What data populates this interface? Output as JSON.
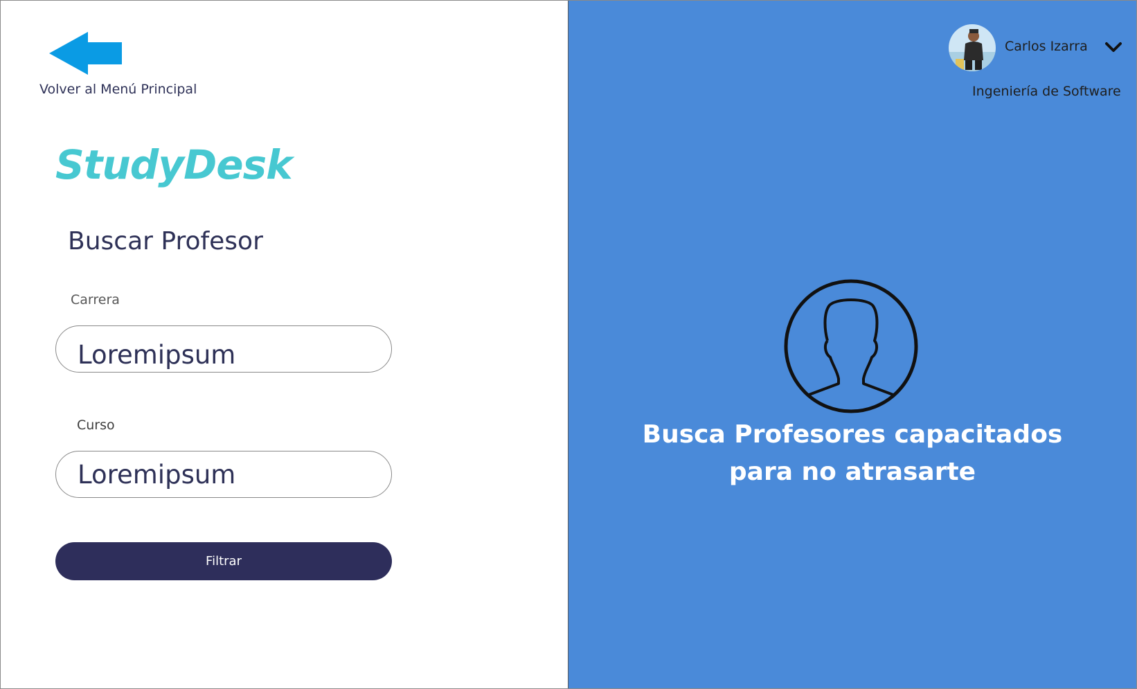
{
  "navigation": {
    "back_label": "Volver al Menú Principal",
    "back_icon": "arrow-left-icon",
    "arrow_color": "#0a9be4"
  },
  "brand": {
    "name": "StudyDesk",
    "color": "#47c8d1"
  },
  "search_form": {
    "title": "Buscar Profesor",
    "career_label": "Carrera",
    "career_value": "Loremipsum",
    "course_label": "Curso",
    "course_value": "Loremipsum",
    "filter_button": "Filtrar",
    "button_color": "#2e2e5b"
  },
  "user": {
    "name": "Carlos Izarra",
    "program": "Ingeniería de Software",
    "avatar_icon": "user-photo",
    "menu_icon": "chevron-down-icon"
  },
  "promo": {
    "icon": "user-circle-icon",
    "line1": "Busca Profesores capacitados",
    "line2": "para no atrasarte",
    "background": "#4a8ad9"
  }
}
